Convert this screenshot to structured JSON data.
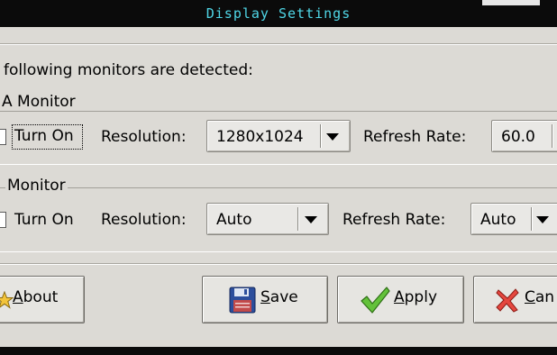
{
  "window": {
    "title": "Display Settings"
  },
  "intro": "following monitors are detected:",
  "monitors": [
    {
      "name": "A Monitor",
      "turn_on_label": "Turn On",
      "resolution_label": "Resolution:",
      "resolution_value": "1280x1024",
      "refresh_label": "Refresh Rate:",
      "refresh_value": "60.0"
    },
    {
      "name": "Monitor",
      "turn_on_label": "Turn On",
      "resolution_label": "Resolution:",
      "resolution_value": "Auto",
      "refresh_label": "Refresh Rate:",
      "refresh_value": "Auto"
    }
  ],
  "buttons": {
    "about": {
      "mnemonic": "A",
      "rest": "bout"
    },
    "save": {
      "mnemonic": "S",
      "rest": "ave"
    },
    "apply": {
      "mnemonic": "A",
      "rest": "pply"
    },
    "cancel": {
      "mnemonic": "C",
      "rest": "an"
    }
  },
  "icons": {
    "about": "star-icon",
    "save": "floppy-disk-icon",
    "apply": "checkmark-icon",
    "cancel": "red-x-icon"
  },
  "colors": {
    "title_text": "#4fd6e6",
    "title_bg": "#0b0b0b",
    "dialog_bg": "#dcdad5"
  }
}
